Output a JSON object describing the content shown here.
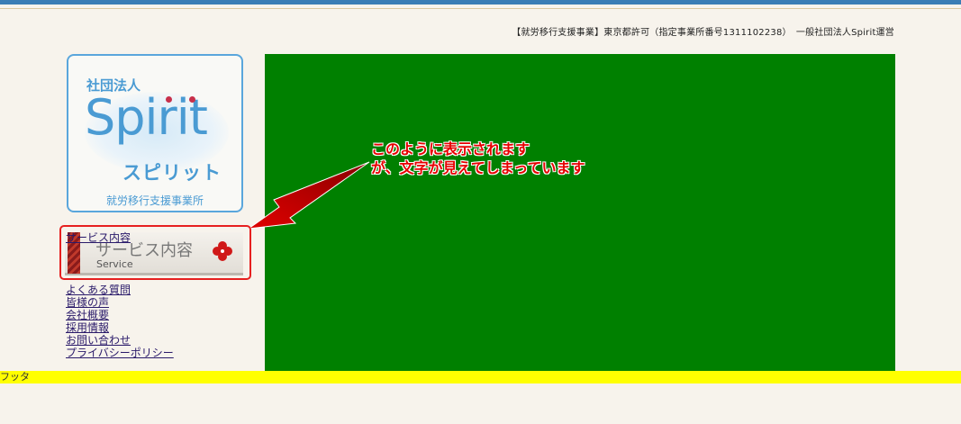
{
  "header": {
    "info": "【就労移行支援事業】東京都許可（指定事業所番号1311102238）　一般社団法人Spirit運営"
  },
  "logo": {
    "subtitle": "社団法人",
    "name": "Spirit",
    "kana": "スピリット",
    "footer": "就労移行支援事業所"
  },
  "hero": {
    "annotation_line1": "このように表示されます",
    "annotation_line2": "が、文字が見えてしまっています",
    "background": "#008000",
    "annotation_color": "#e60000"
  },
  "service": {
    "overlap_text": "サービス内容",
    "title": "サービス内容",
    "subtitle": "Service",
    "icon": "clover-icon"
  },
  "nav": {
    "items": [
      {
        "label": "よくある質問"
      },
      {
        "label": "皆様の声"
      },
      {
        "label": "会社概要"
      },
      {
        "label": "採用情報"
      },
      {
        "label": "お問い合わせ"
      },
      {
        "label": "プライバシーポリシー"
      }
    ]
  },
  "footer": {
    "label": "フッタ",
    "background": "#ffff00"
  }
}
